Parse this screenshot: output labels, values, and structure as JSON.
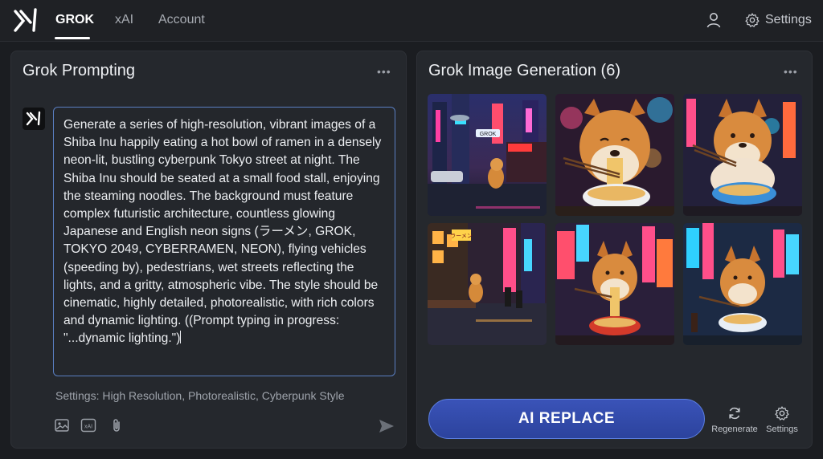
{
  "header": {
    "tabs": [
      "GROK",
      "xAI",
      "Account"
    ],
    "active_tab": "GROK",
    "settings_label": "Settings"
  },
  "left_panel": {
    "title": "Grok Prompting",
    "prompt_text": "Generate a series of high-resolution, vibrant images of a Shiba Inu happily eating a hot bowl of ramen in a densely neon-lit, bustling cyberpunk Tokyo street at night. The Shiba Inu should be seated at a small food stall, enjoying the steaming noodles. The background must feature complex futuristic architecture, countless glowing Japanese and English neon signs (ラーメン, GROK, TOKYO 2049, CYBERRAMEN, NEON), flying vehicles (speeding by), pedestrians, wet streets reflecting the lights, and a gritty, atmospheric vibe. The style should be cinematic, highly detailed, photorealistic, with rich colors and dynamic lighting. ((Prompt typing in progress: \"...dynamic lighting.\")",
    "settings_line": "Settings: High Resolution, Photorealistic, Cyberpunk Style",
    "tools": [
      "image-icon",
      "xai-icon",
      "paperclip-icon"
    ],
    "send_icon": "send-icon"
  },
  "right_panel": {
    "title": "Grok Image Generation (6)",
    "images": [
      {
        "name": "shiba-street-stall-wide",
        "sign": "GROK"
      },
      {
        "name": "shiba-closeup-ramen-chopsticks"
      },
      {
        "name": "shiba-blue-bowl-neon"
      },
      {
        "name": "shiba-alley-stall-rain",
        "sign": "ラーメン"
      },
      {
        "name": "shiba-red-bowl-neon-alley"
      },
      {
        "name": "shiba-blue-neon-street"
      }
    ],
    "primary_button": "AI REPLACE",
    "actions": [
      {
        "label": "Regenerate",
        "icon": "refresh-icon"
      },
      {
        "label": "Settings",
        "icon": "gear-icon"
      }
    ]
  },
  "colors": {
    "background": "#1b1d21",
    "panel": "#25282d",
    "accent": "#3a53b8",
    "prompt_border": "#5a7fc2"
  }
}
